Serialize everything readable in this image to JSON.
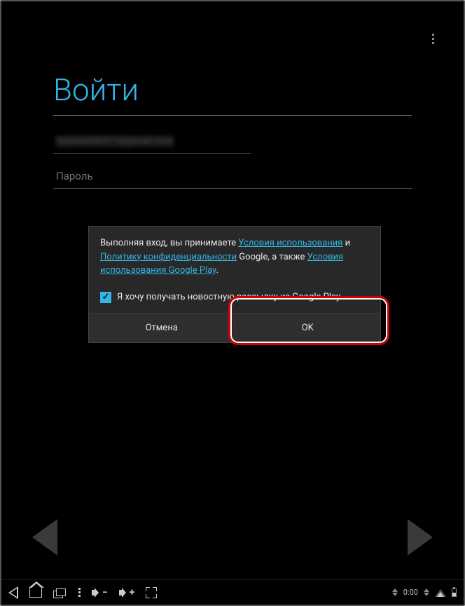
{
  "login": {
    "title": "Войти",
    "email_value": "hidden000211@gmail.com",
    "password_placeholder": "Пароль"
  },
  "dialog": {
    "text_prefix": "Выполняя вход, вы принимаете ",
    "link_tos": "Условия использования",
    "text_and": " и ",
    "link_privacy": "Политику конфиденциальности",
    "text_google": " Google, а также ",
    "link_play_tos": "Условия использования Google Play",
    "text_period": ".",
    "checkbox_label": "Я хочу получать новостную рассылку из Google Play",
    "checkbox_checked": true,
    "cancel": "Отмена",
    "ok": "OK"
  },
  "statusbar": {
    "time": "0:00"
  }
}
